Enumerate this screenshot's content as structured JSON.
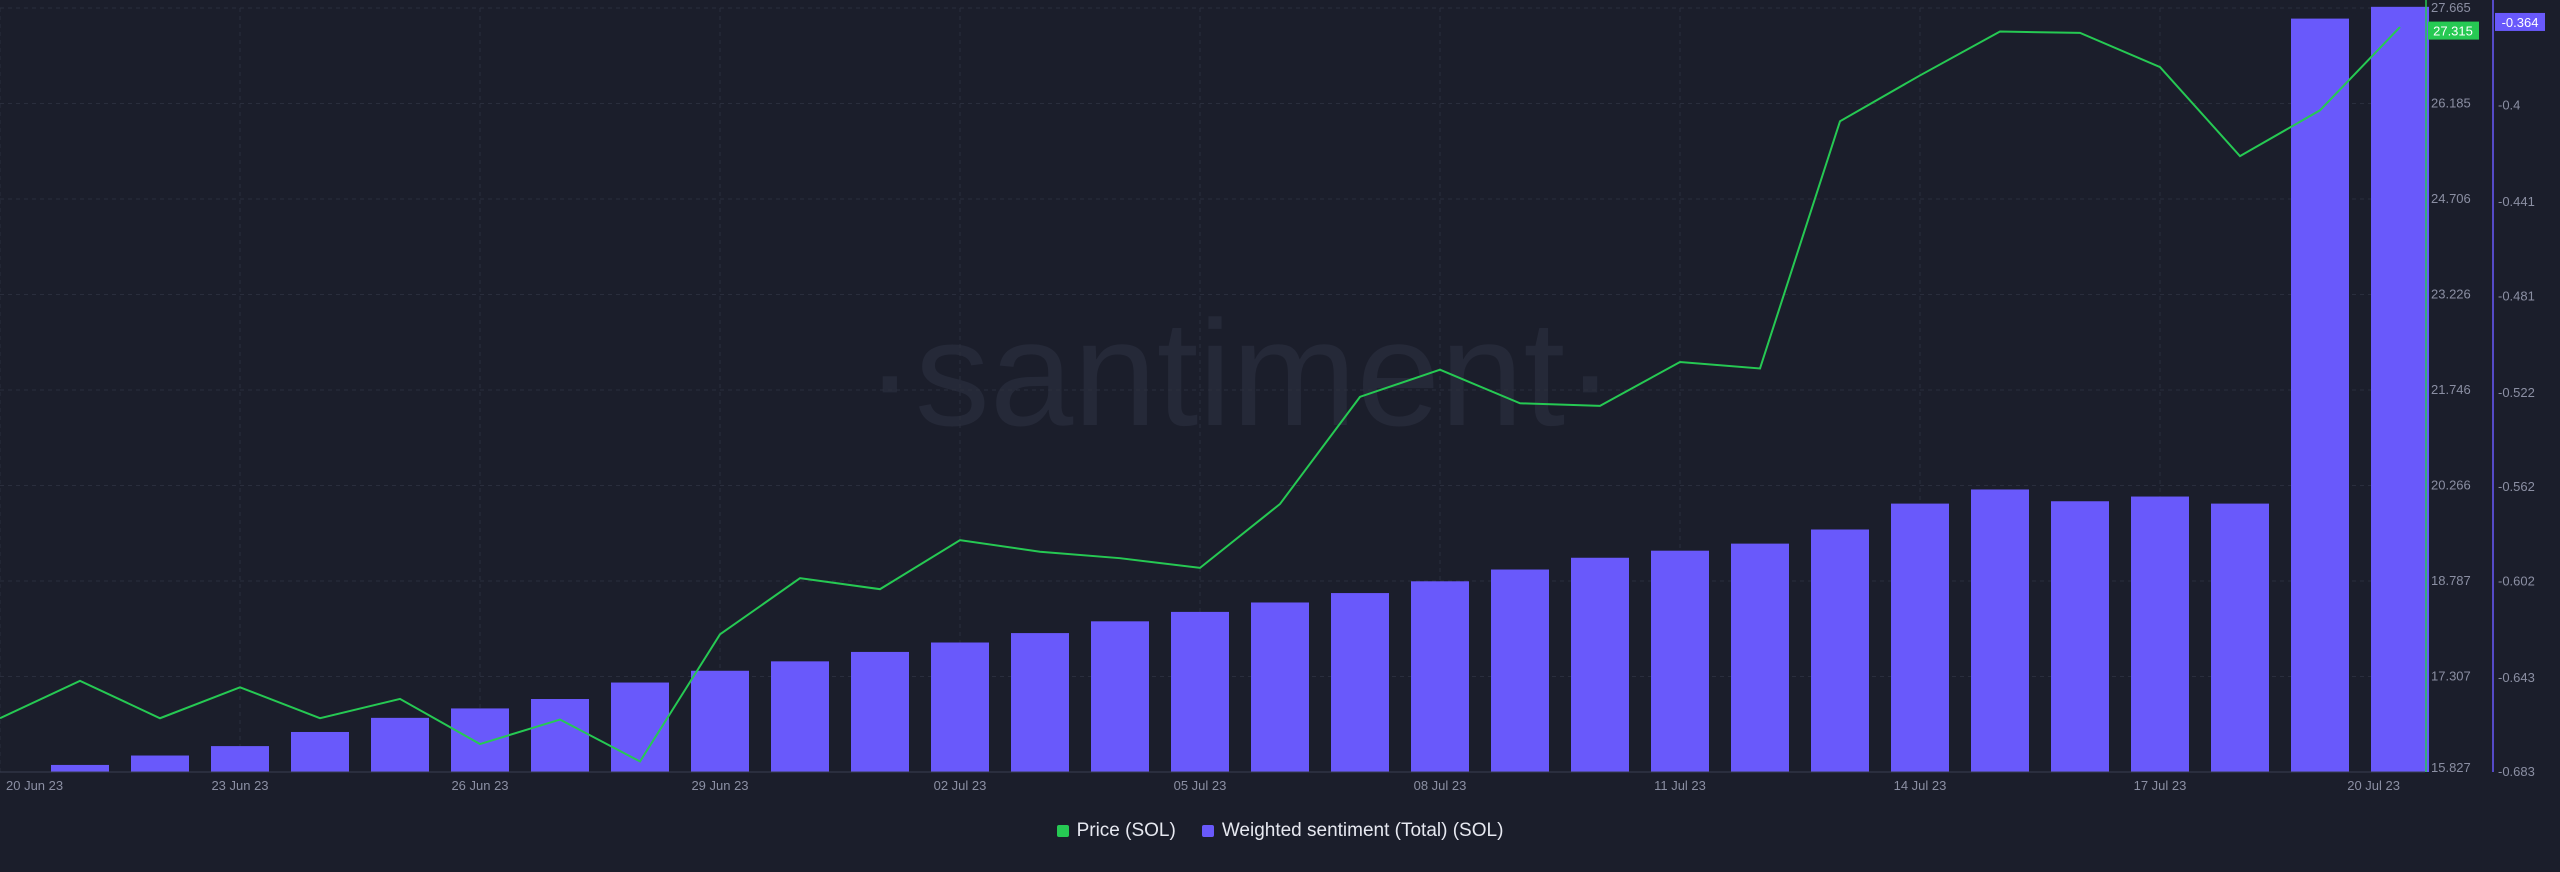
{
  "chart_data": {
    "type": "bar",
    "watermark": "·santiment·",
    "x": [
      "20 Jun 23",
      "21 Jun 23",
      "22 Jun 23",
      "23 Jun 23",
      "24 Jun 23",
      "25 Jun 23",
      "26 Jun 23",
      "27 Jun 23",
      "28 Jun 23",
      "29 Jun 23",
      "30 Jun 23",
      "01 Jul 23",
      "02 Jul 23",
      "03 Jul 23",
      "04 Jul 23",
      "05 Jul 23",
      "06 Jul 23",
      "07 Jul 23",
      "08 Jul 23",
      "09 Jul 23",
      "10 Jul 23",
      "11 Jul 23",
      "12 Jul 23",
      "13 Jul 23",
      "14 Jul 23",
      "15 Jul 23",
      "16 Jul 23",
      "17 Jul 23",
      "18 Jul 23",
      "19 Jul 23",
      "20 Jul 23"
    ],
    "x_tick_labels": [
      "20 Jun 23",
      "23 Jun 23",
      "26 Jun 23",
      "29 Jun 23",
      "02 Jul 23",
      "05 Jul 23",
      "08 Jul 23",
      "11 Jul 23",
      "14 Jul 23",
      "17 Jul 23",
      "20 Jul 23"
    ],
    "series": [
      {
        "name": "Price (SOL)",
        "kind": "line",
        "axis": "price",
        "color": "#26c953",
        "values": [
          16.66,
          17.24,
          16.66,
          17.14,
          16.66,
          16.96,
          16.26,
          16.64,
          15.99,
          17.96,
          18.83,
          18.66,
          19.42,
          19.24,
          19.14,
          18.99,
          19.98,
          21.64,
          22.06,
          21.54,
          21.5,
          22.18,
          22.08,
          25.91,
          26.62,
          27.3,
          27.28,
          26.75,
          25.37,
          26.08,
          27.37
        ]
      },
      {
        "name": "Weighted sentiment (Total) (SOL)",
        "kind": "bar",
        "axis": "sentiment",
        "color": "#6959fb",
        "values": [
          null,
          -0.68,
          -0.676,
          -0.672,
          -0.666,
          -0.66,
          -0.656,
          -0.652,
          -0.645,
          -0.64,
          -0.636,
          -0.632,
          -0.628,
          -0.624,
          -0.619,
          -0.615,
          -0.611,
          -0.607,
          -0.602,
          -0.597,
          -0.592,
          -0.589,
          -0.586,
          -0.58,
          -0.569,
          -0.563,
          -0.568,
          -0.566,
          -0.569,
          -0.363,
          -0.358
        ]
      }
    ],
    "price_axis": {
      "ticks": [
        "27.665",
        "26.185",
        "24.706",
        "23.226",
        "21.746",
        "20.266",
        "18.787",
        "17.307",
        "15.827"
      ],
      "range": [
        15.827,
        27.665
      ],
      "current_label": "27.315"
    },
    "sentiment_axis": {
      "ticks": [
        "-0.4",
        "-0.441",
        "-0.481",
        "-0.522",
        "-0.562",
        "-0.602",
        "-0.643",
        "-0.683"
      ],
      "range": [
        -0.683,
        -0.3585
      ],
      "current_label": "-0.364"
    },
    "grid": true,
    "legend_position": "bottom-center",
    "colors": {
      "background": "#1b1e2b",
      "price": "#26c953",
      "sentiment": "#6959fb",
      "axis_text": "#8b8fa3"
    }
  }
}
